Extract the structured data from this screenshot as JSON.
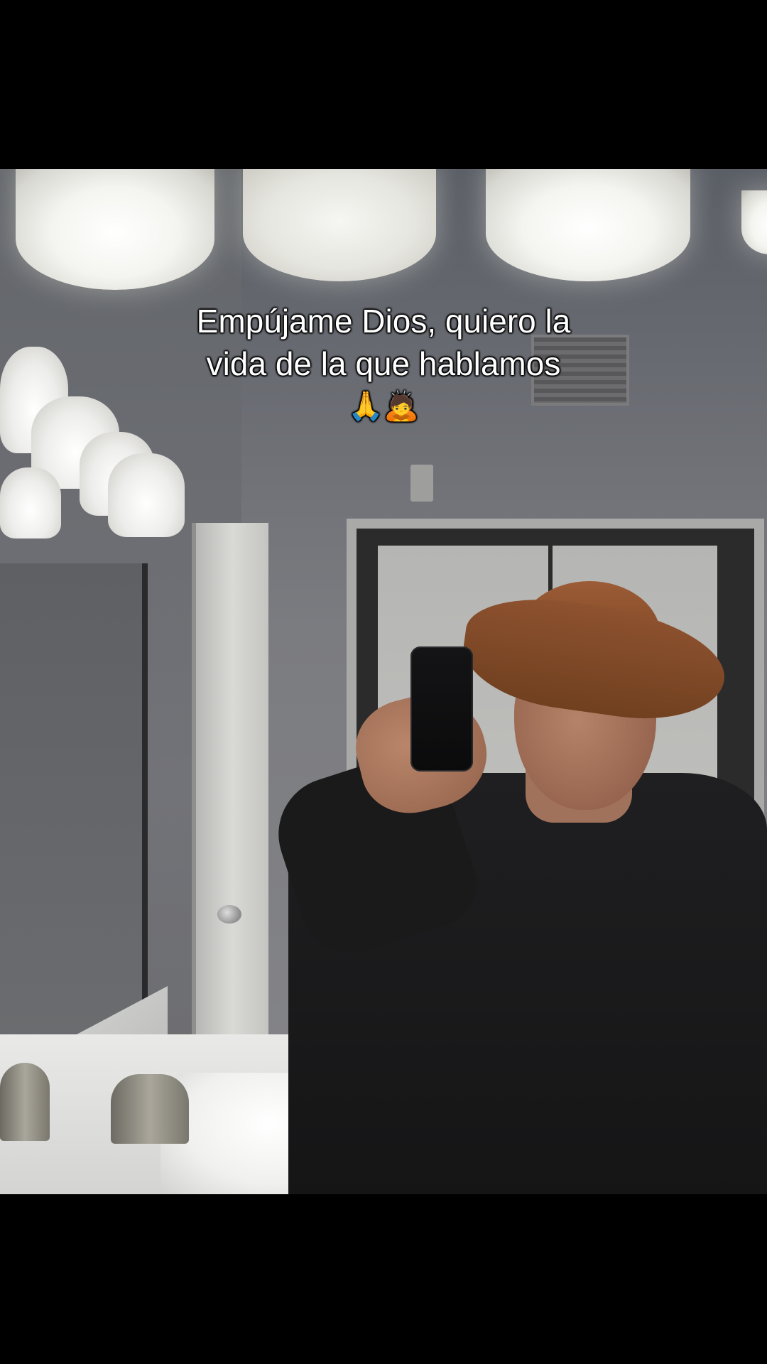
{
  "caption": {
    "line1": "Empújame Dios, quiero la",
    "line2": "vida de la que hablamos",
    "emoji": "🙏🙇"
  }
}
